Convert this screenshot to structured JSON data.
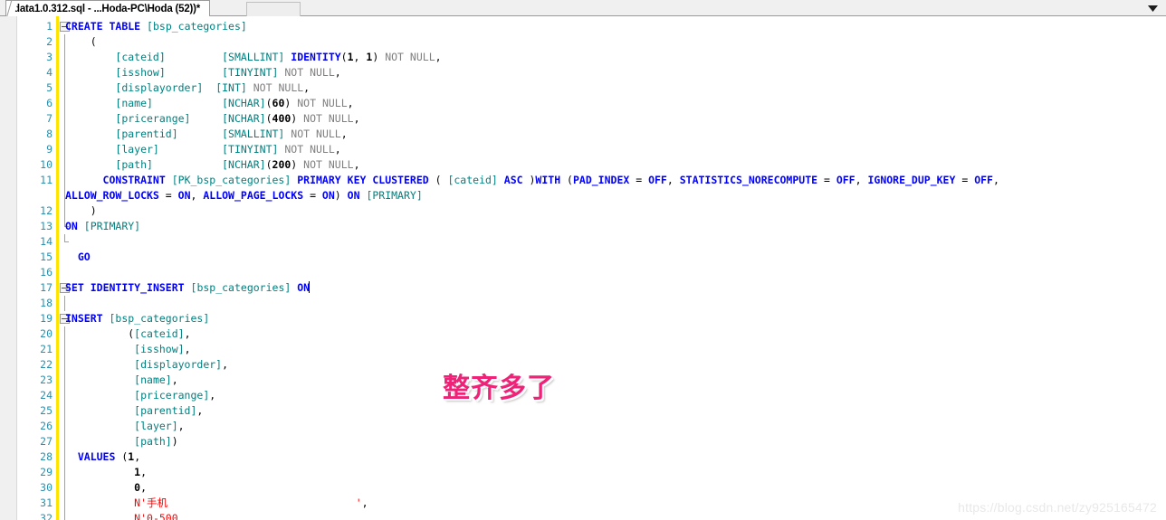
{
  "window": {
    "tab_title": "data1.0.312.sql - ...Hoda-PC\\Hoda (52))*",
    "tab_dropdown_icon": "chevron-down-icon"
  },
  "colors": {
    "keyword": "#0000FF",
    "identifier": "#008080",
    "gray_keyword": "#808080",
    "string": "#FF0000",
    "line_number": "#2B91AF",
    "change_bar": "#FFE400",
    "annotation": "#EE2277",
    "watermark": "#E8E8E8"
  },
  "annotations": {
    "note_text": "整齐多了",
    "watermark_text": "https://blog.csdn.net/zy925165472"
  },
  "editor": {
    "language": "SQL",
    "first_visible_line": 1,
    "last_visible_line": 32,
    "caret_line": 17,
    "lines": [
      {
        "n": "1",
        "fold": "open",
        "text": "CREATE TABLE [bsp_categories]"
      },
      {
        "n": "2",
        "outline": "bar",
        "text": "    ("
      },
      {
        "n": "3",
        "outline": "bar",
        "text": "        [cateid]         [SMALLINT] IDENTITY(1, 1) NOT NULL,"
      },
      {
        "n": "4",
        "outline": "bar",
        "text": "        [isshow]         [TINYINT] NOT NULL,"
      },
      {
        "n": "5",
        "outline": "bar",
        "text": "        [displayorder]  [INT] NOT NULL,"
      },
      {
        "n": "6",
        "outline": "bar",
        "text": "        [name]           [NCHAR](60) NOT NULL,"
      },
      {
        "n": "7",
        "outline": "bar",
        "text": "        [pricerange]     [NCHAR](400) NOT NULL,"
      },
      {
        "n": "8",
        "outline": "bar",
        "text": "        [parentid]       [SMALLINT] NOT NULL,"
      },
      {
        "n": "9",
        "outline": "bar",
        "text": "        [layer]          [TINYINT] NOT NULL,"
      },
      {
        "n": "10",
        "outline": "bar",
        "text": "        [path]           [NCHAR](200) NOT NULL,"
      },
      {
        "n": "11",
        "outline": "bar",
        "text": "      CONSTRAINT [PK_bsp_categories] PRIMARY KEY CLUSTERED ( [cateid] ASC )WITH (PAD_INDEX = OFF, STATISTICS_NORECOMPUTE = OFF, IGNORE_DUP_KEY = OFF,",
        "wrap": "ALLOW_ROW_LOCKS = ON, ALLOW_PAGE_LOCKS = ON) ON [PRIMARY]"
      },
      {
        "n": "12",
        "outline": "bar",
        "text": "    )"
      },
      {
        "n": "13",
        "outline": "end",
        "text": "ON [PRIMARY]"
      },
      {
        "n": "14",
        "outline": "close",
        "text": ""
      },
      {
        "n": "15",
        "outline": "none",
        "text": "  GO"
      },
      {
        "n": "16",
        "outline": "none",
        "text": ""
      },
      {
        "n": "17",
        "fold": "open",
        "text": "SET IDENTITY_INSERT [bsp_categories] ON"
      },
      {
        "n": "18",
        "outline": "bar",
        "text": ""
      },
      {
        "n": "19",
        "fold": "open",
        "text": "INSERT [bsp_categories]"
      },
      {
        "n": "20",
        "outline": "bar",
        "text": "          ([cateid],"
      },
      {
        "n": "21",
        "outline": "bar",
        "text": "           [isshow],"
      },
      {
        "n": "22",
        "outline": "bar",
        "text": "           [displayorder],"
      },
      {
        "n": "23",
        "outline": "bar",
        "text": "           [name],"
      },
      {
        "n": "24",
        "outline": "bar",
        "text": "           [pricerange],"
      },
      {
        "n": "25",
        "outline": "bar",
        "text": "           [parentid],"
      },
      {
        "n": "26",
        "outline": "bar",
        "text": "           [layer],"
      },
      {
        "n": "27",
        "outline": "bar",
        "text": "           [path])"
      },
      {
        "n": "28",
        "outline": "bar",
        "text": "  VALUES (1,"
      },
      {
        "n": "29",
        "outline": "bar",
        "text": "           1,"
      },
      {
        "n": "30",
        "outline": "bar",
        "text": "           0,"
      },
      {
        "n": "31",
        "outline": "bar",
        "text": "           N'手机                              ',"
      },
      {
        "n": "32",
        "outline": "bar",
        "text": "           N'0-500"
      }
    ]
  }
}
